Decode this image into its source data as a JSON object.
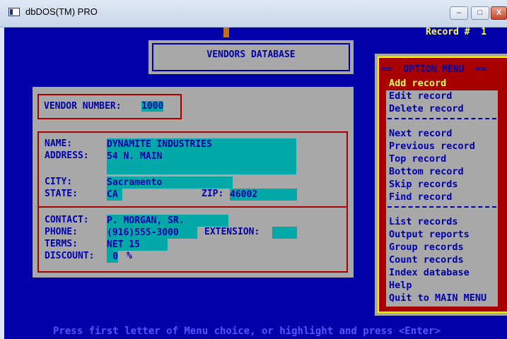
{
  "window": {
    "title": "dbDOS(TM) PRO",
    "minimize": "–",
    "maximize": "□",
    "close": "X"
  },
  "status": {
    "record_label": "Record #  1"
  },
  "header": {
    "title": "VENDORS DATABASE"
  },
  "vendor_number": {
    "label": "VENDOR NUMBER:",
    "value": "1000"
  },
  "fields": {
    "name": {
      "label": "NAME:",
      "value": "DYNAMITE INDUSTRIES"
    },
    "address": {
      "label": "ADDRESS:",
      "value": "54 N. MAIN"
    },
    "city": {
      "label": "CITY:",
      "value": "Sacramento"
    },
    "state": {
      "label": "STATE:",
      "value": "CA"
    },
    "zip": {
      "label": "ZIP:",
      "value": "46002"
    },
    "contact": {
      "label": "CONTACT:",
      "value": "P. MORGAN, SR."
    },
    "phone": {
      "label": "PHONE:",
      "value": "(916)555-3000"
    },
    "extension": {
      "label": "EXTENSION:",
      "value": ""
    },
    "terms": {
      "label": "TERMS:",
      "value": "NET 15"
    },
    "discount": {
      "label": "DISCOUNT:",
      "value": "0",
      "unit": "%"
    }
  },
  "menu": {
    "title": "==  OPTION MENU  ==",
    "items": [
      "Add record",
      "Edit record",
      "Delete record",
      "Next record",
      "Previous record",
      "Top record",
      "Bottom record",
      "Skip records",
      "Find record",
      "List records",
      "Output reports",
      "Group records",
      "Count records",
      "Index database",
      "Help",
      "Quit to MAIN MENU"
    ],
    "selected": "Add record"
  },
  "footer": {
    "hint": "Press first letter of Menu choice, or highlight and press <Enter>"
  },
  "colors": {
    "background": "#0000a8",
    "panel": "#a8a8a8",
    "field": "#00a8a8",
    "border": "#a80000",
    "highlight_text": "#fcfc54"
  }
}
